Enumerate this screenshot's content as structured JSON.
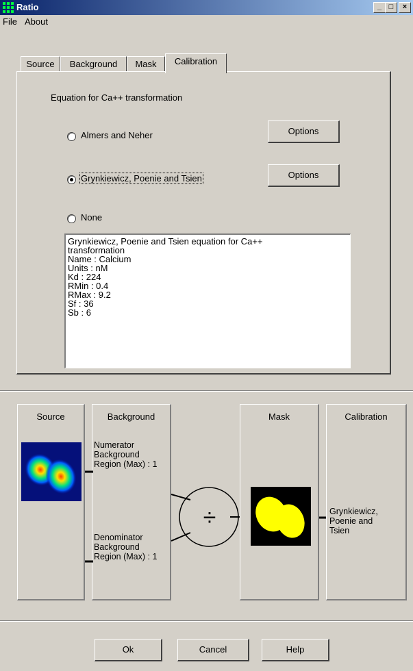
{
  "window": {
    "title": "Ratio",
    "minimize": "_",
    "maximize": "□",
    "close": "×"
  },
  "menu": [
    "File",
    "About"
  ],
  "tabs": [
    "Source",
    "Background",
    "Mask",
    "Calibration"
  ],
  "calibration": {
    "heading": "Equation for Ca++ transformation",
    "options": [
      {
        "label": "Almers and Neher",
        "selected": false,
        "button": "Options"
      },
      {
        "label": "Grynkiewicz, Poenie and Tsien",
        "selected": true,
        "button": "Options"
      },
      {
        "label": "None",
        "selected": false
      }
    ],
    "details": "Grynkiewicz, Poenie and Tsien equation for Ca++\ntransformation\nName : Calcium\nUnits : nM\nKd : 224\nRMin : 0.4\nRMax : 9.2\nSf : 36\nSb : 6"
  },
  "pipeline": {
    "source": {
      "title": "Source"
    },
    "background": {
      "title": "Background",
      "numerator": "Numerator\nBackground\nRegion (Max) : 1",
      "denominator": "Denominator\nBackground\nRegion (Max) : 1"
    },
    "divide": "÷",
    "mask": {
      "title": "Mask"
    },
    "calibration": {
      "title": "Calibration",
      "value": "Grynkiewicz,\nPoenie and\nTsien"
    }
  },
  "buttons": {
    "ok": "Ok",
    "cancel": "Cancel",
    "help": "Help"
  },
  "colors": {
    "titlebar_start": "#0a246a",
    "titlebar_end": "#a6caf0",
    "face": "#d4d0c8",
    "mask_fill": "#ffff00"
  },
  "icons": [
    "app-icon",
    "minimize-icon",
    "maximize-icon",
    "close-icon",
    "radio-icon",
    "divide-icon"
  ]
}
